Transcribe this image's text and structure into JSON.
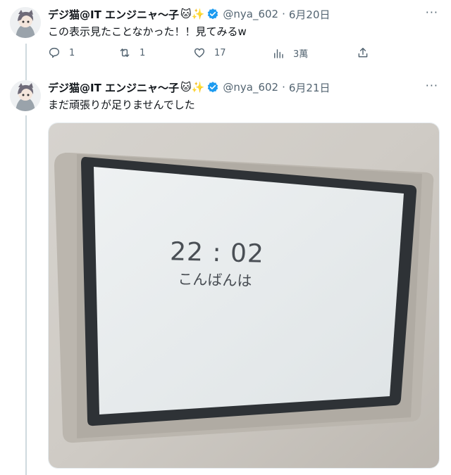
{
  "tweets": [
    {
      "display_name": "デジ猫@IT エンジニャ～子",
      "emoji": "🐱✨",
      "handle": "@nya_602",
      "date": "6月20日",
      "text": "この表示見たことなかった！！見てみるw",
      "actions": {
        "replies": "1",
        "retweets": "1",
        "likes": "17",
        "views": "3萬"
      }
    },
    {
      "display_name": "デジ猫@IT エンジニャ～子",
      "emoji": "🐱✨",
      "handle": "@nya_602",
      "date": "6月21日",
      "text": "まだ頑張りが足りませんでした",
      "image": {
        "time": "22 : 02",
        "greeting": "こんばんは"
      }
    }
  ],
  "ui": {
    "separator": "·",
    "more": "···"
  },
  "colors": {
    "text": "#0f1419",
    "muted": "#536471",
    "verified": "#1d9bf0",
    "thread_line": "#cfd9de"
  }
}
